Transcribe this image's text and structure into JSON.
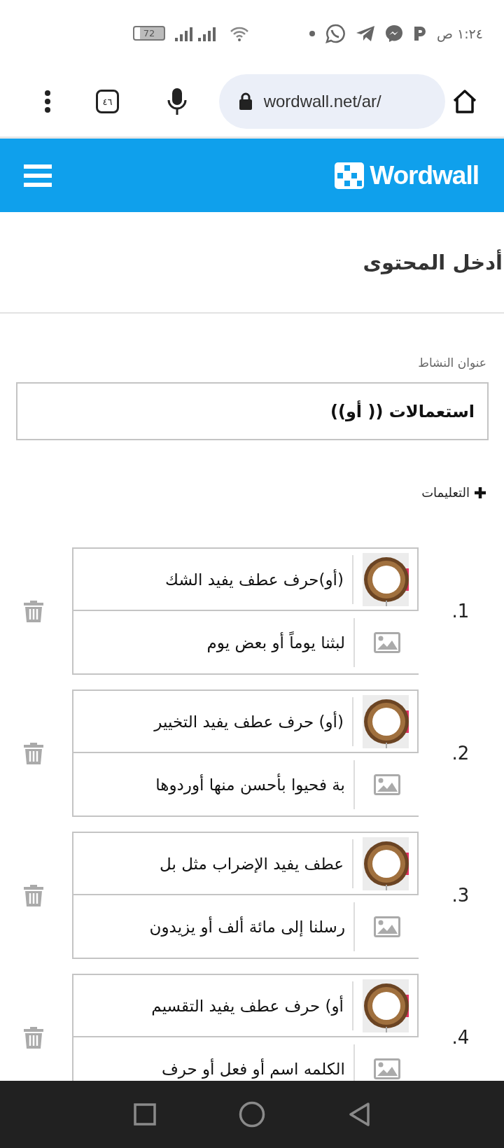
{
  "status_bar": {
    "time": "١:٢٤ ص",
    "battery": "72"
  },
  "browser": {
    "url": "wordwall.net/ar/",
    "tab_count": "٤٦"
  },
  "header": {
    "logo": "Wordwall"
  },
  "page": {
    "heading": "أدخل المحتوى",
    "title_label": "عنوان النشاط",
    "title_value": "استعمالات (( أو))",
    "instructions": "التعليمات"
  },
  "items": [
    {
      "number": "1.",
      "front": "(أو)حرف عطف يفيد الشك",
      "back": "لبثنا يوماً أو بعض يوم"
    },
    {
      "number": "2.",
      "front": "(أو) حرف عطف يفيد التخيير",
      "back": "بة فحيوا بأحسن منها أوردوها"
    },
    {
      "number": "3.",
      "front": "عطف يفيد الإضراب مثل بل",
      "back": "رسلنا إلى مائة ألف أو يزيدون"
    },
    {
      "number": "4.",
      "front": "أو) حرف عطف يفيد التقسيم",
      "back": "الكلمه اسم أو فعل أو حرف"
    }
  ]
}
